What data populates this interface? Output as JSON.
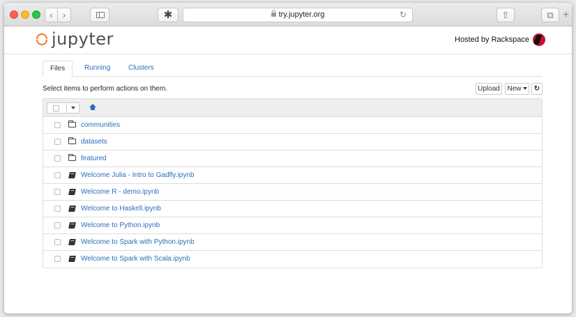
{
  "browser": {
    "url": "try.jupyter.org",
    "ext_glyph": "✱"
  },
  "header": {
    "logo_text": "jupyter",
    "hosted_by": "Hosted by Rackspace"
  },
  "tabs": [
    {
      "label": "Files",
      "active": true
    },
    {
      "label": "Running",
      "active": false
    },
    {
      "label": "Clusters",
      "active": false
    }
  ],
  "toolbar": {
    "instructions": "Select items to perform actions on them.",
    "upload_label": "Upload",
    "new_label": "New",
    "refresh_glyph": "↻"
  },
  "files": [
    {
      "name": "communities",
      "type": "folder"
    },
    {
      "name": "datasets",
      "type": "folder"
    },
    {
      "name": "featured",
      "type": "folder"
    },
    {
      "name": "Welcome Julia - Intro to Gadfly.ipynb",
      "type": "notebook"
    },
    {
      "name": "Welcome R - demo.ipynb",
      "type": "notebook"
    },
    {
      "name": "Welcome to Haskell.ipynb",
      "type": "notebook"
    },
    {
      "name": "Welcome to Python.ipynb",
      "type": "notebook"
    },
    {
      "name": "Welcome to Spark with Python.ipynb",
      "type": "notebook"
    },
    {
      "name": "Welcome to Spark with Scala.ipynb",
      "type": "notebook"
    }
  ],
  "colors": {
    "link": "#2a6ebb",
    "jupyter_orange": "#f37726",
    "rackspace_red": "#c8102e"
  }
}
